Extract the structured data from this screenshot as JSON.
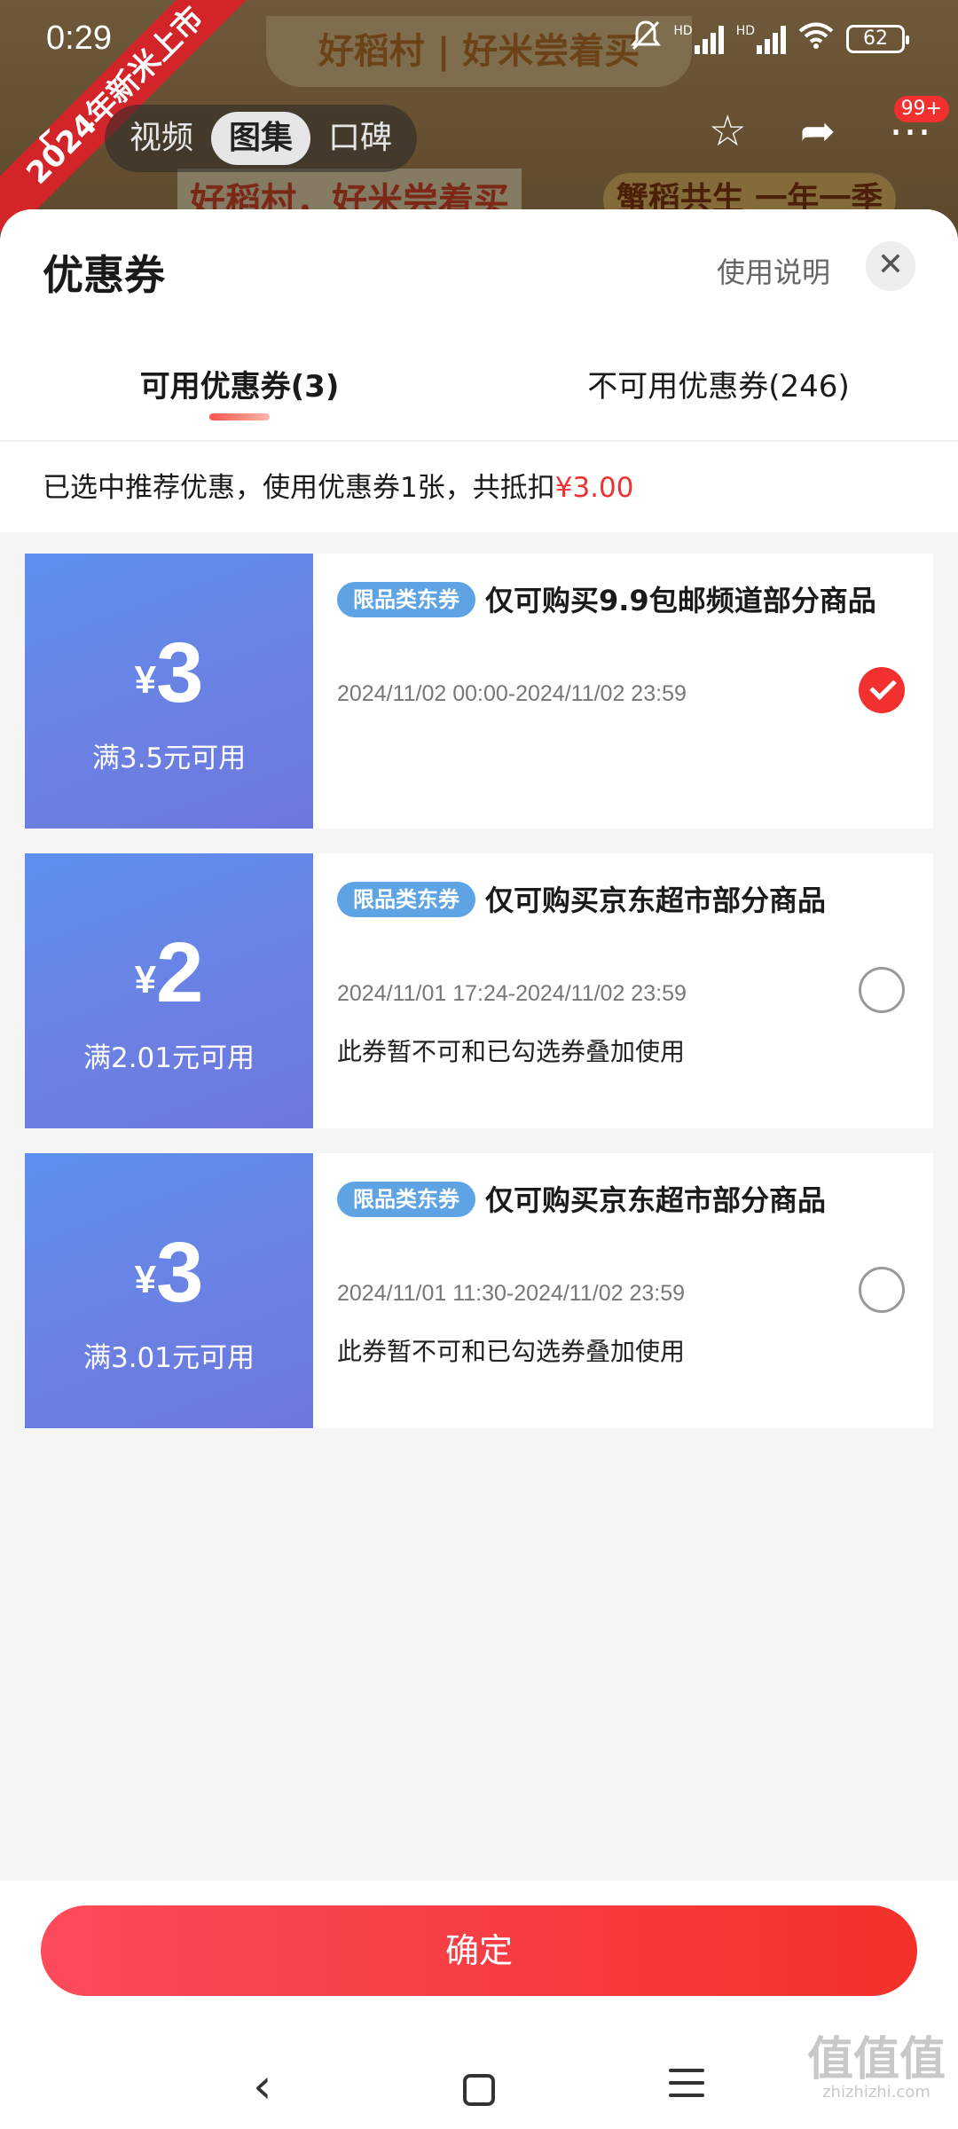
{
  "status_bar": {
    "time": "0:29",
    "hd1": "HD",
    "hd2": "HD",
    "battery": "62"
  },
  "background": {
    "banner_title": "好稻村 | 好米尝着买",
    "ribbon": "2024年新米上市",
    "sub_left": "好稻村，好米尝着买",
    "sub_right": "蟹稻共生 一年一季"
  },
  "top_nav": {
    "tabs": [
      "视频",
      "图集",
      "口碑"
    ],
    "active_tab": "图集",
    "badge": "99+"
  },
  "sheet": {
    "title": "优惠券",
    "help_label": "使用说明",
    "tabs": [
      {
        "label": "可用优惠券(3)",
        "active": true
      },
      {
        "label": "不可用优惠券(246)",
        "active": false
      }
    ],
    "summary_prefix": "已选中推荐优惠，使用优惠券1张，共抵扣",
    "summary_amount": "¥3.00"
  },
  "coupons": [
    {
      "currency": "¥",
      "amount": "3",
      "threshold": "满3.5元可用",
      "tag": "限品类东券",
      "title": "仅可购买9.9包邮频道部分商品",
      "validity": "2024/11/02 00:00-2024/11/02 23:59",
      "note": "",
      "selected": true
    },
    {
      "currency": "¥",
      "amount": "2",
      "threshold": "满2.01元可用",
      "tag": "限品类东券",
      "title": "仅可购买京东超市部分商品",
      "validity": "2024/11/01 17:24-2024/11/02 23:59",
      "note": "此券暂不可和已勾选券叠加使用",
      "selected": false
    },
    {
      "currency": "¥",
      "amount": "3",
      "threshold": "满3.01元可用",
      "tag": "限品类东券",
      "title": "仅可购买京东超市部分商品",
      "validity": "2024/11/01 11:30-2024/11/02 23:59",
      "note": "此券暂不可和已勾选券叠加使用",
      "selected": false
    }
  ],
  "footer": {
    "confirm_label": "确定"
  },
  "watermark": {
    "main": "值值值",
    "sub": "zhizhizhi.com"
  },
  "colors": {
    "accent_red": "#f23030",
    "coupon_blue": "#6c80e2",
    "tag_blue": "#5ea4e4"
  }
}
